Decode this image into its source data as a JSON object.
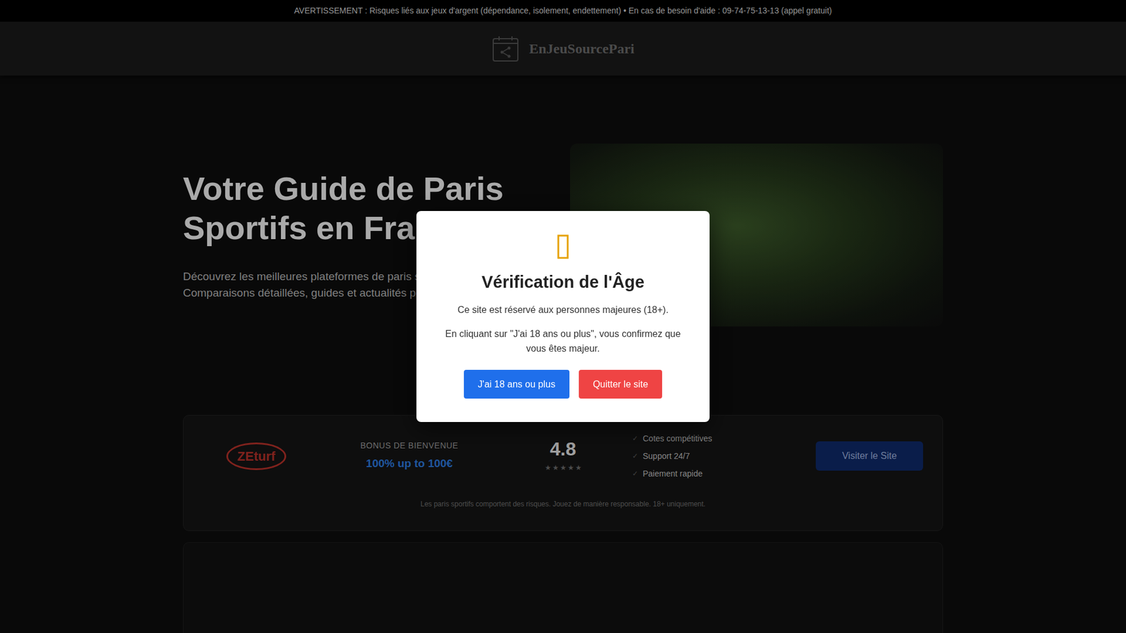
{
  "warning_bar": {
    "text": "AVERTISSEMENT : Risques liés aux jeux d'argent (dépendance, isolement, endettement) • En cas de besoin d'aide : 09-74-75-13-13 (appel gratuit)"
  },
  "header": {
    "logo_text": "EnJeuSourcePari"
  },
  "hero": {
    "title_lines": [
      "Votre Guide de Paris",
      "Sportifs en Fra"
    ],
    "subtitle_lines": [
      "Découvrez les meilleures plateformes de paris spo",
      "Comparaisons détaillées, guides et actualités pour"
    ]
  },
  "bookmakers": [
    {
      "logo_text": "ZEturf",
      "bonus_label": "BONUS DE BIENVENUE",
      "bonus": "100% up to 100€",
      "rating": "4.8",
      "stars": 5,
      "features": [
        {
          "icon": "✓",
          "text": "Cotes compétitives"
        },
        {
          "icon": "✓",
          "text": "Support 24/7"
        },
        {
          "icon": "✓",
          "text": "Paiement rapide"
        }
      ],
      "button": "Visiter le Site",
      "disclaimer": "Les paris sportifs comportent des risques. Jouez de manière responsable. 18+ uniquement."
    }
  ],
  "modal": {
    "title": "Vérification de l'Âge",
    "paragraphs": [
      "Ce site est réservé aux personnes majeures (18+).",
      "En cliquant sur \"J'ai 18 ans ou plus\", vous confirmez que vous êtes majeur."
    ],
    "buttons": [
      {
        "label": "J'ai 18 ans ou plus",
        "kind": "confirm"
      },
      {
        "label": "Quitter le site",
        "kind": "leave"
      }
    ]
  }
}
